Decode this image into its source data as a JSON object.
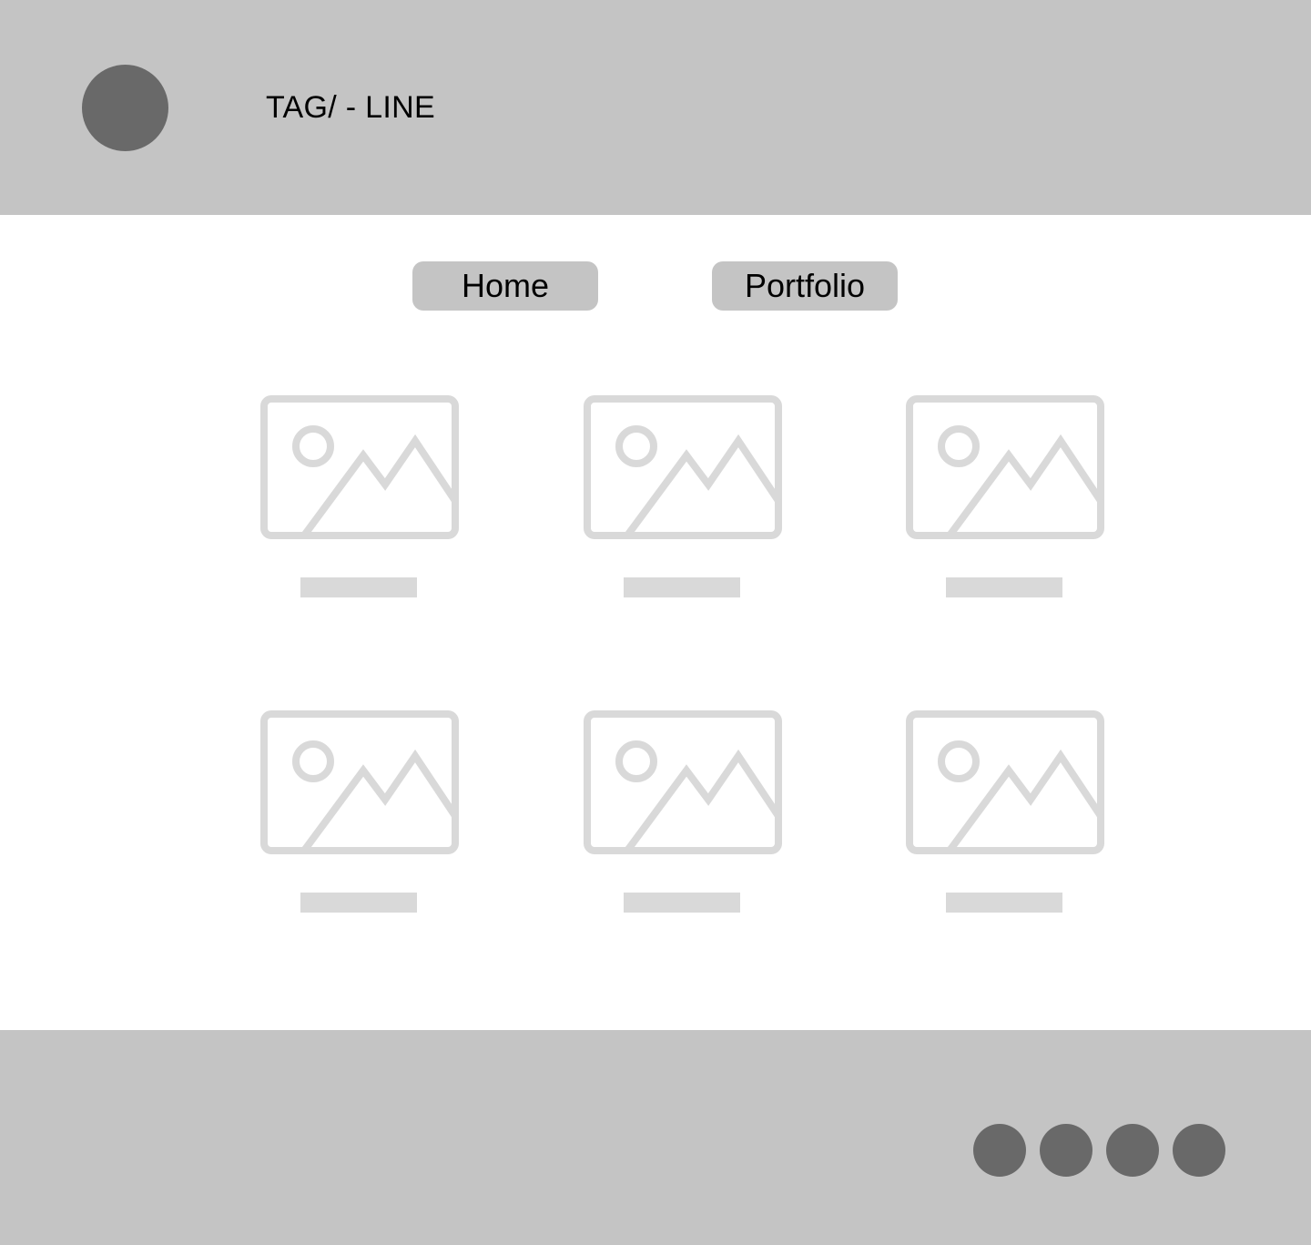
{
  "header": {
    "tagline": "TAG/ - LINE",
    "logo_icon": "logo-circle-icon"
  },
  "nav": {
    "items": [
      {
        "label": "Home"
      },
      {
        "label": "Portfolio"
      }
    ]
  },
  "gallery": {
    "image_icon": "image-placeholder-icon",
    "items": [
      {
        "caption": ""
      },
      {
        "caption": ""
      },
      {
        "caption": ""
      },
      {
        "caption": ""
      },
      {
        "caption": ""
      },
      {
        "caption": ""
      }
    ]
  },
  "footer": {
    "social_icons": [
      "social-icon-1",
      "social-icon-2",
      "social-icon-3",
      "social-icon-4"
    ]
  },
  "colors": {
    "header_bg": "#c4c4c4",
    "footer_bg": "#c4c4c4",
    "button_bg": "#c4c4c4",
    "circle_fill": "#696969",
    "placeholder_stroke": "#d9d9d9",
    "page_bg": "#ffffff"
  }
}
